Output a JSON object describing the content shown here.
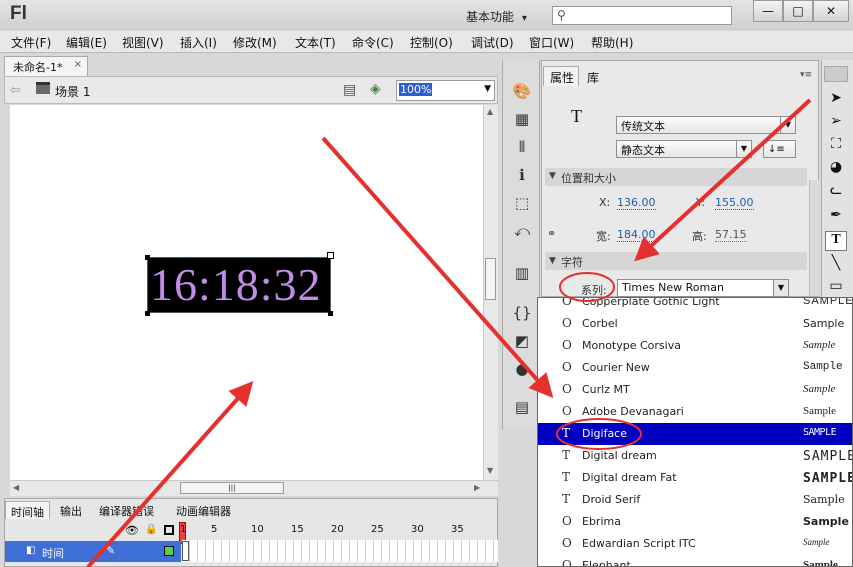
{
  "app": {
    "logo": "Fl",
    "workspace": "基本功能",
    "workspace_arrow": "▾"
  },
  "window_controls": {
    "minimize": "—",
    "restore": "□",
    "close": "✕"
  },
  "menu": [
    "文件(F)",
    "编辑(E)",
    "视图(V)",
    "插入(I)",
    "修改(M)",
    "文本(T)",
    "命令(C)",
    "控制(O)",
    "调试(D)",
    "窗口(W)",
    "帮助(H)"
  ],
  "document": {
    "tab_title": "未命名-1*",
    "close": "×",
    "scene": "场景 1",
    "zoom": "100%"
  },
  "stage": {
    "clock_text": "16:18:32"
  },
  "timeline": {
    "tabs": [
      "时间轴",
      "输出",
      "编译器错误",
      "动画编辑器"
    ],
    "frame_numbers": [
      "1",
      "5",
      "10",
      "15",
      "20",
      "25",
      "30",
      "35"
    ],
    "layer_name": "时间"
  },
  "properties": {
    "tabs": [
      "属性",
      "库"
    ],
    "text_icon": "T",
    "text_engine": "传统文本",
    "text_type": "静态文本",
    "position_section": "位置和大小",
    "x_label": "X:",
    "x_value": "136.00",
    "y_label": "Y:",
    "y_value": "155.00",
    "w_label": "宽:",
    "w_value": "184.00",
    "h_label": "高:",
    "h_value": "57.15",
    "char_section": "字符",
    "family_label": "系列:",
    "family_value": "Times New Roman"
  },
  "font_list": [
    {
      "name": "Copperplate Gothic Light",
      "sample": "SAMPLE",
      "icon": "O"
    },
    {
      "name": "Corbel",
      "sample": "Sample",
      "icon": "O"
    },
    {
      "name": "Monotype Corsiva",
      "sample": "Sample",
      "icon": "O"
    },
    {
      "name": "Courier New",
      "sample": "Sample",
      "icon": "O"
    },
    {
      "name": "Curlz MT",
      "sample": "Sample",
      "icon": "O"
    },
    {
      "name": "Adobe Devanagari",
      "sample": "Sample",
      "icon": "O"
    },
    {
      "name": "Digiface",
      "sample": "SAMPLE",
      "icon": "T",
      "selected": true
    },
    {
      "name": "Digital dream",
      "sample": "SAMPLE",
      "icon": "T"
    },
    {
      "name": "Digital dream Fat",
      "sample": "SAMPLE",
      "icon": "T"
    },
    {
      "name": "Droid Serif",
      "sample": "Sample",
      "icon": "T"
    },
    {
      "name": "Ebrima",
      "sample": "Sample",
      "icon": "O"
    },
    {
      "name": "Edwardian Script ITC",
      "sample": "Sample",
      "icon": "O"
    },
    {
      "name": "Elephant",
      "sample": "Sample",
      "icon": "O"
    }
  ],
  "colors": {
    "annotation_red": "#e53030",
    "selection_blue": "#0000c0",
    "clock_purple": "#c08ce8"
  }
}
